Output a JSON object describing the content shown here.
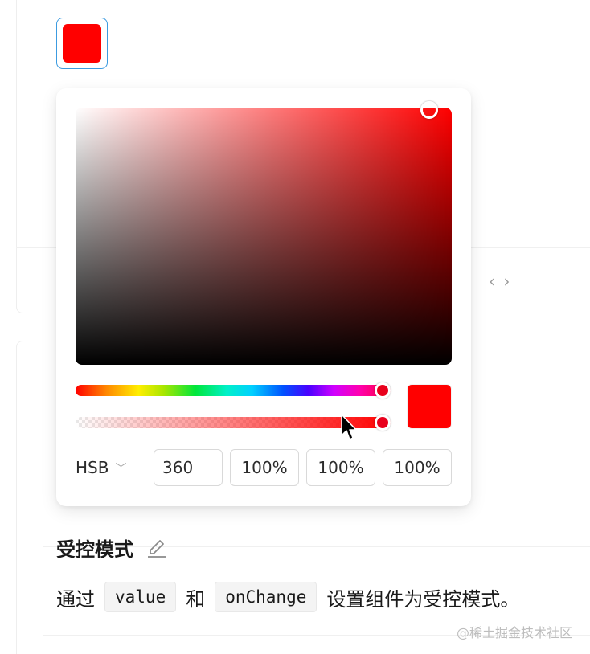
{
  "colors": {
    "selected": "#ff0000",
    "picker_hue_handle": "#e8001c",
    "trigger_border": "#3c9be0"
  },
  "code_toggle": {
    "glyph": "‹ ›",
    "icon": "code-toggle-icon"
  },
  "color_picker": {
    "hue_value": 1.0,
    "alpha_value": 1.0,
    "saturation": 1.0,
    "brightness": 1.0,
    "format": "HSB",
    "format_chevron": "﹀",
    "inputs": {
      "hue": "360",
      "saturation": "100%",
      "brightness": "100%",
      "alpha": "100%"
    }
  },
  "section": {
    "title": "受控模式",
    "edit_icon": "edit-icon",
    "desc_prefix": "通过",
    "code_value": "value",
    "desc_and": "和",
    "code_onchange": "onChange",
    "desc_suffix": "设置组件为受控模式。"
  },
  "watermark": "@稀土掘金技术社区"
}
